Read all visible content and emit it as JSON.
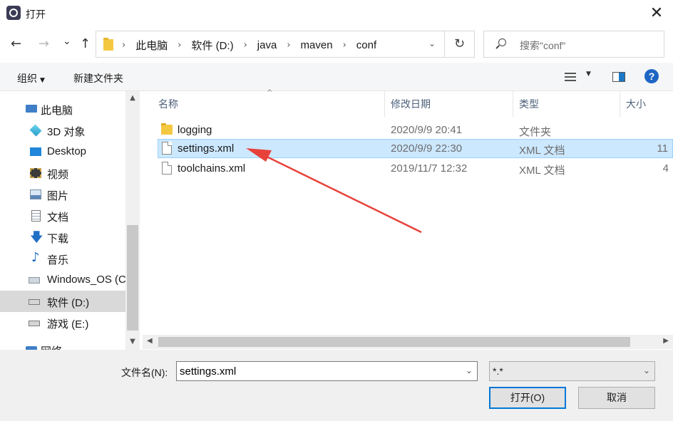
{
  "window": {
    "title": "打开",
    "close_glyph": "✕"
  },
  "nav": {
    "back": "←",
    "forward": "→",
    "recent": "⌄",
    "up": "↑",
    "breadcrumbs": [
      "此电脑",
      "软件 (D:)",
      "java",
      "maven",
      "conf"
    ],
    "refresh": "↻",
    "search_placeholder": "搜索\"conf\""
  },
  "toolbar": {
    "organize": "组织",
    "new_folder": "新建文件夹",
    "help": "?"
  },
  "sidebar": {
    "items": [
      {
        "label": "此电脑",
        "icon": "computer-icon"
      },
      {
        "label": "3D 对象",
        "icon": "cube-icon"
      },
      {
        "label": "Desktop",
        "icon": "desktop-icon"
      },
      {
        "label": "视频",
        "icon": "film-icon"
      },
      {
        "label": "图片",
        "icon": "picture-icon"
      },
      {
        "label": "文档",
        "icon": "document-icon"
      },
      {
        "label": "下载",
        "icon": "download-icon"
      },
      {
        "label": "音乐",
        "icon": "music-icon"
      },
      {
        "label": "Windows_OS (C",
        "icon": "windows-drive-icon"
      },
      {
        "label": "软件 (D:)",
        "icon": "drive-icon",
        "selected": true
      },
      {
        "label": "游戏 (E:)",
        "icon": "drive-icon"
      },
      {
        "label": "网络",
        "icon": "network-icon"
      }
    ]
  },
  "filelist": {
    "columns": [
      "名称",
      "修改日期",
      "类型",
      "大小"
    ],
    "rows": [
      {
        "name": "logging",
        "date": "2020/9/9 20:41",
        "type": "文件夹",
        "size": "",
        "icon": "folder-icon"
      },
      {
        "name": "settings.xml",
        "date": "2020/9/9 22:30",
        "type": "XML 文档",
        "size": "11",
        "icon": "file-icon",
        "selected": true
      },
      {
        "name": "toolchains.xml",
        "date": "2019/11/7 12:32",
        "type": "XML 文档",
        "size": "4",
        "icon": "file-icon"
      }
    ]
  },
  "footer": {
    "filename_label": "文件名(N):",
    "filename_value": "settings.xml",
    "filter_value": "*.*",
    "open_button": "打开(O)",
    "cancel_button": "取消"
  },
  "colors": {
    "selection": "#cce8ff",
    "accent": "#0078d7",
    "annotation_arrow": "#e8413a"
  }
}
